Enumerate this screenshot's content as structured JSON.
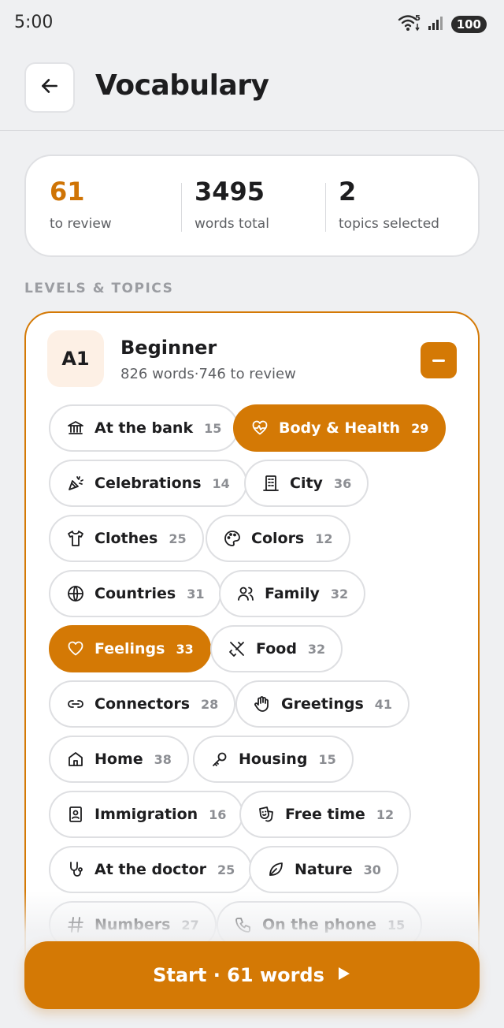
{
  "status": {
    "time": "5:00",
    "battery": "100",
    "wifi_badge": "5"
  },
  "header": {
    "title": "Vocabulary"
  },
  "stats": [
    {
      "value": "61",
      "label": "to review"
    },
    {
      "value": "3495",
      "label": "words total"
    },
    {
      "value": "2",
      "label": "topics selected"
    }
  ],
  "section_label": "LEVELS & TOPICS",
  "level": {
    "badge": "A1",
    "name": "Beginner",
    "words": "826 words",
    "review": "746 to review",
    "separator": "·"
  },
  "topics": [
    {
      "name": "At the bank",
      "count": "15",
      "icon": "bank-icon",
      "selected": false
    },
    {
      "name": "Body & Health",
      "count": "29",
      "icon": "heart-pulse-icon",
      "selected": true
    },
    {
      "name": "Celebrations",
      "count": "14",
      "icon": "party-popper-icon",
      "selected": false
    },
    {
      "name": "City",
      "count": "36",
      "icon": "building-icon",
      "selected": false
    },
    {
      "name": "Clothes",
      "count": "25",
      "icon": "shirt-icon",
      "selected": false
    },
    {
      "name": "Colors",
      "count": "12",
      "icon": "palette-icon",
      "selected": false
    },
    {
      "name": "Countries",
      "count": "31",
      "icon": "globe-icon",
      "selected": false
    },
    {
      "name": "Family",
      "count": "32",
      "icon": "users-icon",
      "selected": false
    },
    {
      "name": "Feelings",
      "count": "33",
      "icon": "heart-icon",
      "selected": true
    },
    {
      "name": "Food",
      "count": "32",
      "icon": "utensils-crossed-icon",
      "selected": false
    },
    {
      "name": "Connectors",
      "count": "28",
      "icon": "link-icon",
      "selected": false
    },
    {
      "name": "Greetings",
      "count": "41",
      "icon": "hand-icon",
      "selected": false
    },
    {
      "name": "Home",
      "count": "38",
      "icon": "home-icon",
      "selected": false
    },
    {
      "name": "Housing",
      "count": "15",
      "icon": "key-icon",
      "selected": false
    },
    {
      "name": "Immigration",
      "count": "16",
      "icon": "passport-icon",
      "selected": false
    },
    {
      "name": "Free time",
      "count": "12",
      "icon": "theater-mask-icon",
      "selected": false
    },
    {
      "name": "At the doctor",
      "count": "25",
      "icon": "stethoscope-icon",
      "selected": false
    },
    {
      "name": "Nature",
      "count": "30",
      "icon": "leaf-icon",
      "selected": false
    },
    {
      "name": "Numbers",
      "count": "27",
      "icon": "hash-icon",
      "selected": false
    },
    {
      "name": "On the phone",
      "count": "15",
      "icon": "phone-icon",
      "selected": false
    }
  ],
  "start_button": {
    "label": "Start · 61 words"
  },
  "colors": {
    "accent": "#d47905",
    "accent_text": "#cf7405",
    "background": "#eff0f2"
  }
}
